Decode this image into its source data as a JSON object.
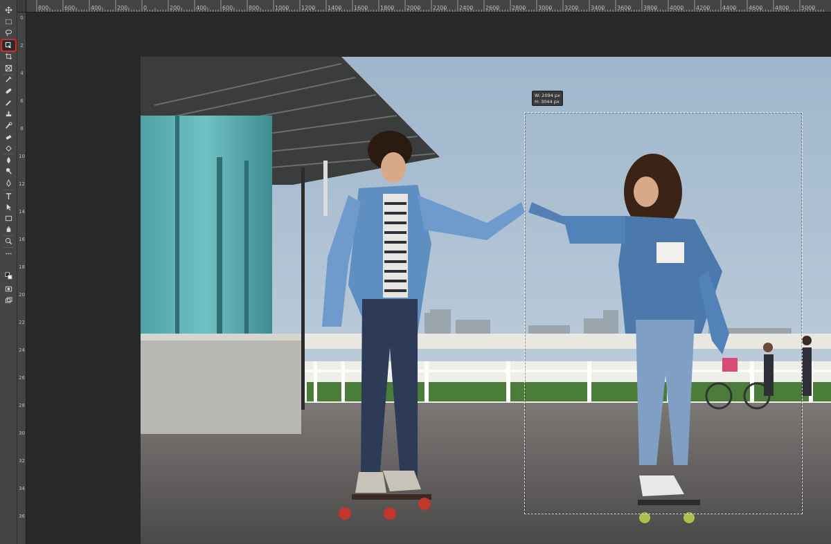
{
  "ruler": {
    "top_ticks": [
      "800",
      "600",
      "400",
      "200",
      "0",
      "200",
      "400",
      "600",
      "800",
      "1000",
      "1200",
      "1400",
      "1600",
      "1800",
      "2000",
      "2200",
      "2400",
      "2600",
      "2800",
      "3000",
      "3200",
      "3400",
      "3600",
      "3800",
      "4000",
      "4200",
      "4400",
      "4600",
      "4800",
      "5000"
    ],
    "left_ticks": [
      "0",
      "2",
      "4",
      "6",
      "8",
      "10",
      "12",
      "14",
      "16",
      "18",
      "20",
      "22",
      "24",
      "26",
      "28",
      "30",
      "32",
      "34",
      "36"
    ]
  },
  "toolbar": {
    "tools": [
      {
        "name": "move-tool",
        "icon": "move-icon"
      },
      {
        "name": "marquee-tool",
        "icon": "marquee-icon"
      },
      {
        "name": "lasso-tool",
        "icon": "lasso-icon"
      },
      {
        "name": "object-selection-tool",
        "icon": "object-selection-icon",
        "active": true
      },
      {
        "name": "crop-tool",
        "icon": "crop-icon"
      },
      {
        "name": "frame-tool",
        "icon": "frame-icon"
      },
      {
        "name": "eyedropper-tool",
        "icon": "eyedropper-icon"
      },
      {
        "name": "healing-brush-tool",
        "icon": "bandage-icon"
      },
      {
        "name": "brush-tool",
        "icon": "brush-icon"
      },
      {
        "name": "clone-stamp-tool",
        "icon": "stamp-icon"
      },
      {
        "name": "history-brush-tool",
        "icon": "history-brush-icon"
      },
      {
        "name": "eraser-tool",
        "icon": "eraser-icon"
      },
      {
        "name": "gradient-tool",
        "icon": "paint-bucket-icon"
      },
      {
        "name": "blur-tool",
        "icon": "droplet-icon"
      },
      {
        "name": "dodge-tool",
        "icon": "dodge-icon"
      },
      {
        "name": "pen-tool",
        "icon": "pen-icon"
      },
      {
        "name": "type-tool",
        "icon": "type-icon"
      },
      {
        "name": "path-selection-tool",
        "icon": "arrow-icon"
      },
      {
        "name": "rectangle-tool",
        "icon": "rectangle-icon"
      },
      {
        "name": "hand-tool",
        "icon": "hand-icon"
      },
      {
        "name": "zoom-tool",
        "icon": "zoom-icon"
      },
      {
        "name": "edit-toolbar",
        "icon": "more-icon"
      },
      {
        "name": "color-swatches",
        "icon": "swatch-icon"
      },
      {
        "name": "quick-mask",
        "icon": "mask-icon"
      },
      {
        "name": "screen-mode",
        "icon": "screen-mode-icon"
      }
    ]
  },
  "selection": {
    "width_label": "W: 2094 px",
    "height_label": "H: 3044 px"
  },
  "colors": {
    "active_tool_outline": "#e3261f",
    "ui_background": "#282828",
    "toolbar_background": "#454545"
  }
}
